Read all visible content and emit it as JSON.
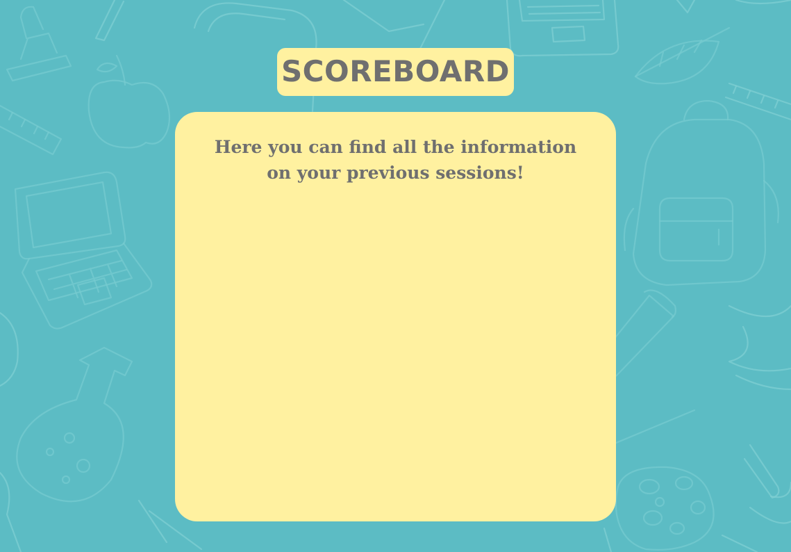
{
  "header": {
    "title": "SCOREBOARD"
  },
  "panel": {
    "description": "Here you can find all the information on your previous sessions!"
  },
  "theme": {
    "background": "#5cbcc4",
    "doodle_stroke": "#7fcfd3",
    "panel_fill": "#fff1a0",
    "text_color": "#6f6f6f"
  },
  "decorations": [
    "stamp-doodle-icon",
    "apple-doodle-icon",
    "ruler-doodle-icon",
    "laptop-doodle-icon",
    "flask-doodle-icon",
    "backpack-doodle-icon",
    "leaf-doodle-icon",
    "test-tube-doodle-icon",
    "palette-doodle-icon"
  ]
}
